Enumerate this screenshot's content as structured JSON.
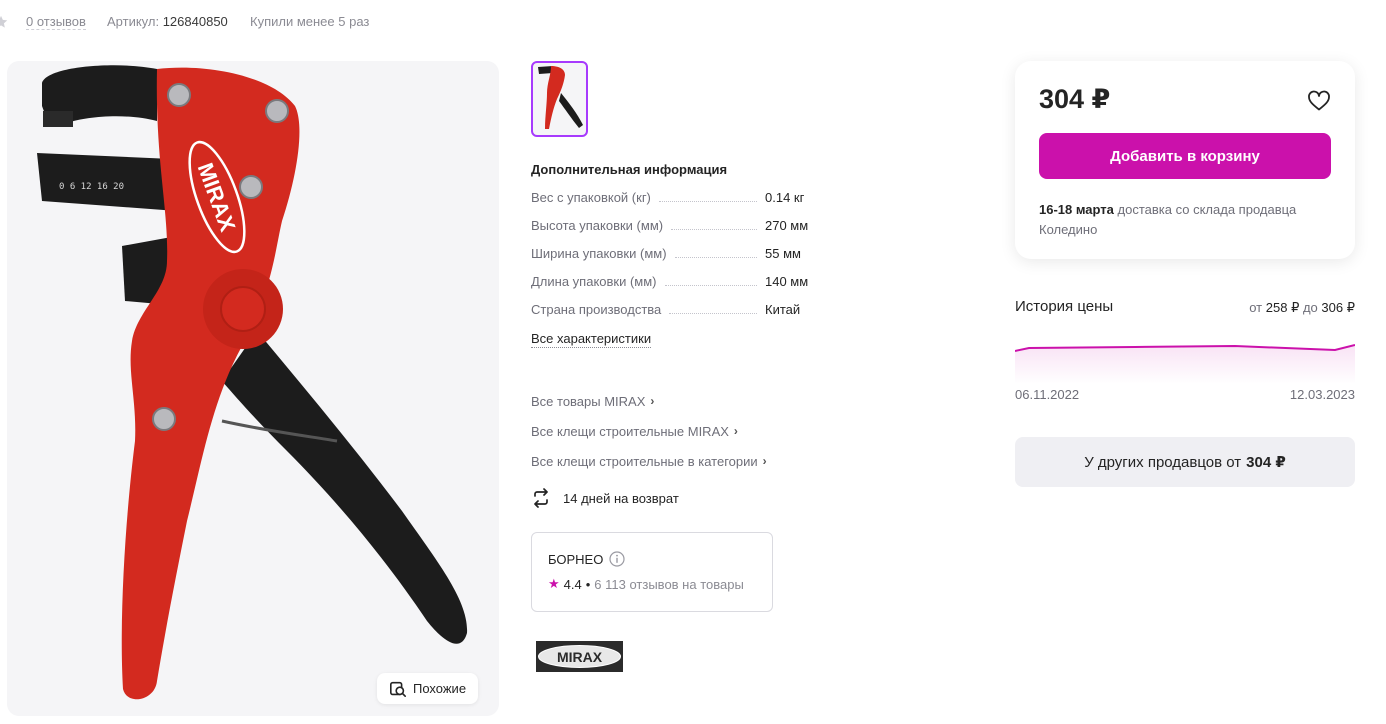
{
  "meta": {
    "reviews": "0 отзывов",
    "article_label": "Артикул:",
    "article_value": "126840850",
    "bought": "Купили менее 5 раз"
  },
  "gallery": {
    "similar_label": "Похожие",
    "product_brand_text": "MIRAX",
    "ruler_text": "0 6 12 16 20"
  },
  "info": {
    "title": "Дополнительная информация",
    "specs": [
      {
        "label": "Вес с упаковкой (кг)",
        "value": "0.14 кг"
      },
      {
        "label": "Высота упаковки (мм)",
        "value": "270 мм"
      },
      {
        "label": "Ширина упаковки (мм)",
        "value": "55 мм"
      },
      {
        "label": "Длина упаковки (мм)",
        "value": "140 мм"
      },
      {
        "label": "Страна производства",
        "value": "Китай"
      }
    ],
    "all_specs": "Все характеристики",
    "links": [
      "Все товары MIRAX",
      "Все клещи строительные MIRAX",
      "Все клещи строительные в категории"
    ],
    "return_policy": "14 дней на возврат"
  },
  "seller": {
    "name": "БОРНЕО",
    "rating": "4.4",
    "separator": "•",
    "reviews": "6 113 отзывов на товары"
  },
  "brand": {
    "logo_text": "MIRAX"
  },
  "buy": {
    "price": "304 ₽",
    "add_to_cart": "Добавить в корзину",
    "delivery_date": "16-18 марта",
    "delivery_text": "доставка со склада продавца Коледино"
  },
  "price_history": {
    "title": "История цены",
    "from_label": "от",
    "min": "258 ₽",
    "to_label": "до",
    "max": "306 ₽",
    "date_start": "06.11.2022",
    "date_end": "12.03.2023"
  },
  "other_sellers": {
    "label": "У других продавцов от",
    "price": "304 ₽"
  },
  "colors": {
    "accent": "#cb11ab",
    "thumb_border": "#a73afd",
    "product_red": "#d32a1f",
    "product_black": "#1c1c1c"
  }
}
